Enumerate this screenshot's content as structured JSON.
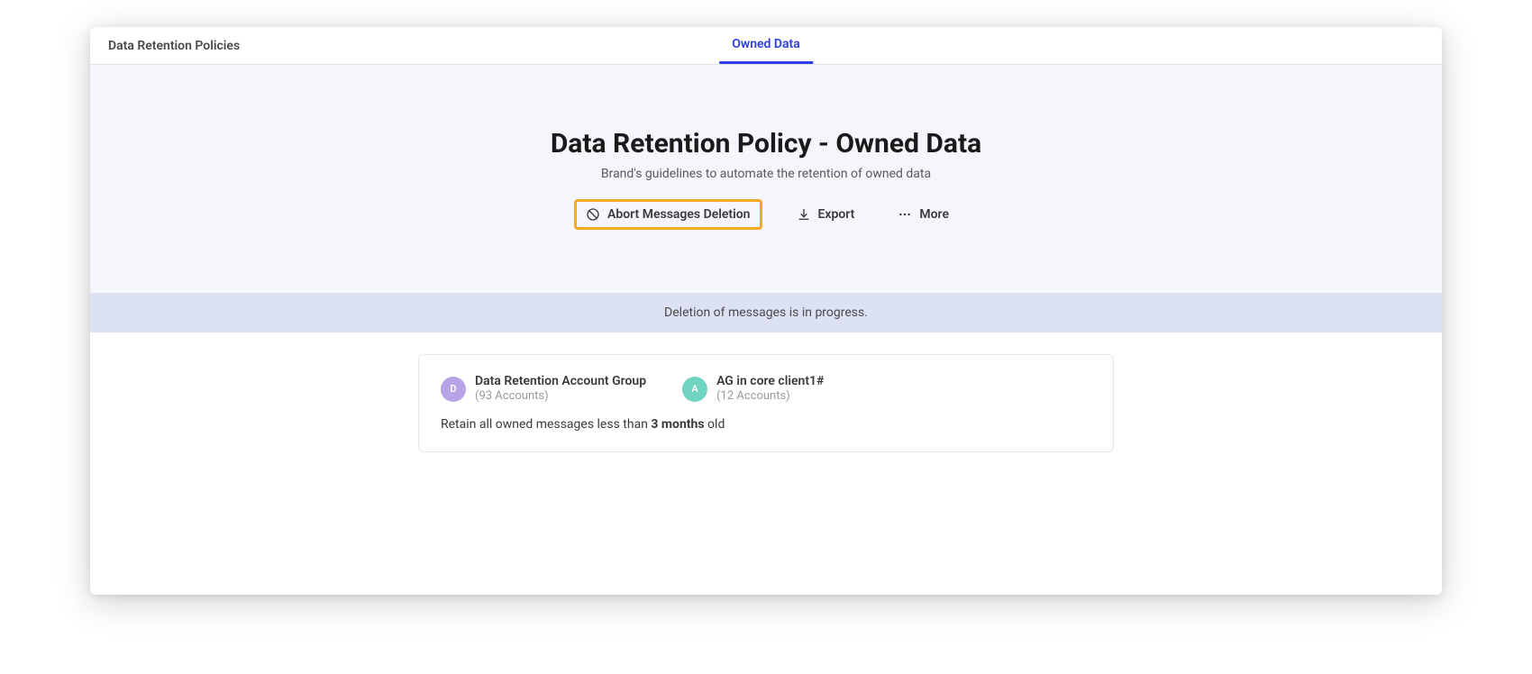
{
  "topbar": {
    "breadcrumb": "Data Retention Policies",
    "active_tab": "Owned Data"
  },
  "hero": {
    "title": "Data Retention Policy - Owned Data",
    "subtitle": "Brand's guidelines to automate the retention of owned data",
    "actions": {
      "abort": "Abort Messages Deletion",
      "export": "Export",
      "more": "More"
    }
  },
  "status": "Deletion of messages is in progress.",
  "card": {
    "groups": [
      {
        "initial": "D",
        "name": "Data Retention Account Group",
        "count": "(93 Accounts)"
      },
      {
        "initial": "A",
        "name": "AG in core client1#",
        "count": "(12 Accounts)"
      }
    ],
    "retain_prefix": "Retain all owned messages less than ",
    "retain_bold": "3 months",
    "retain_suffix": " old"
  }
}
